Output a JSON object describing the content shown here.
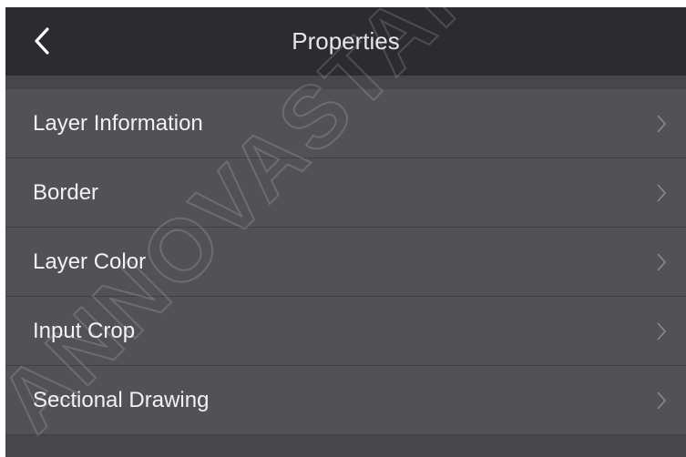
{
  "header": {
    "title": "Properties",
    "back_icon": "chevron-left-icon"
  },
  "menu": {
    "items": [
      {
        "label": "Layer Information",
        "icon": "chevron-right-icon"
      },
      {
        "label": "Border",
        "icon": "chevron-right-icon"
      },
      {
        "label": "Layer Color",
        "icon": "chevron-right-icon"
      },
      {
        "label": "Input Crop",
        "icon": "chevron-right-icon"
      },
      {
        "label": "Sectional Drawing",
        "icon": "chevron-right-icon"
      }
    ]
  },
  "watermark": {
    "text": "ANNOVASTAR"
  },
  "colors": {
    "header_bg": "#2c2c30",
    "item_bg": "#515156",
    "divider": "#3f3f44",
    "text": "#f2f2f4",
    "chevron": "#8a8a90"
  }
}
